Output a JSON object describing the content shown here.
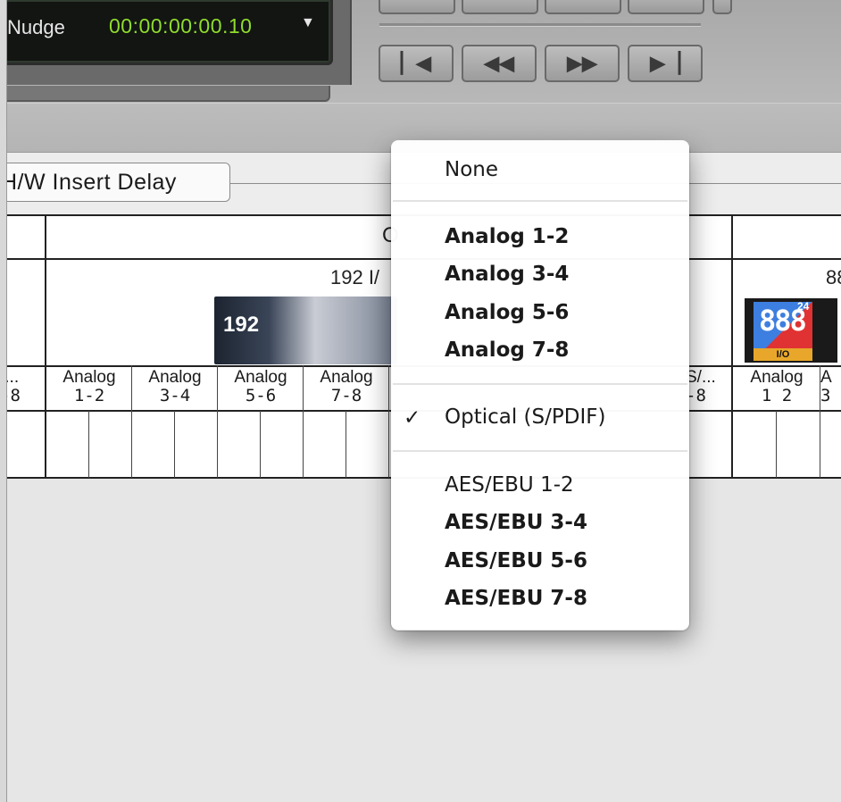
{
  "transport": {
    "nudge_label": "Nudge",
    "nudge_value": "00:00:00:00.10",
    "nudge_arrow": "▼",
    "buttons": [
      {
        "name": "go-to-start-icon",
        "glyph": "⏮"
      },
      {
        "name": "rewind-icon",
        "glyph": "◀◀"
      },
      {
        "name": "fast-forward-icon",
        "glyph": "▶▶"
      },
      {
        "name": "go-to-end-icon",
        "glyph": "⏭"
      }
    ]
  },
  "tab": {
    "hw_insert_delay": "H/W Insert Delay"
  },
  "grid": {
    "group_header_partial": "O",
    "device_192_label": "192 I/",
    "device_888_label": "88",
    "device_192_badge": "192",
    "device_888_badge": "888",
    "device_888_super": "24",
    "device_888_io": "I/O",
    "columns": [
      {
        "line1": "/...",
        "line2": "-8"
      },
      {
        "line1": "Analog",
        "line2": "1-2"
      },
      {
        "line1": "Analog",
        "line2": "3-4"
      },
      {
        "line1": "Analog",
        "line2": "5-6"
      },
      {
        "line1": "Analog",
        "line2": "7-8"
      },
      {
        "line1": "S/...",
        "line2": "-8"
      },
      {
        "line1": "Analog",
        "line2": "1  2"
      },
      {
        "line1": "A",
        "line2": "3"
      }
    ]
  },
  "menu": {
    "items": {
      "none": "None",
      "analog_1_2": "Analog 1-2",
      "analog_3_4": "Analog 3-4",
      "analog_5_6": "Analog 5-6",
      "analog_7_8": "Analog 7-8",
      "optical": "Optical (S/PDIF)",
      "aes_1_2": "AES/EBU 1-2",
      "aes_3_4": "AES/EBU 3-4",
      "aes_5_6": "AES/EBU 5-6",
      "aes_7_8": "AES/EBU 7-8"
    },
    "checked_item": "Optical (S/PDIF)",
    "check_glyph": "✓"
  }
}
